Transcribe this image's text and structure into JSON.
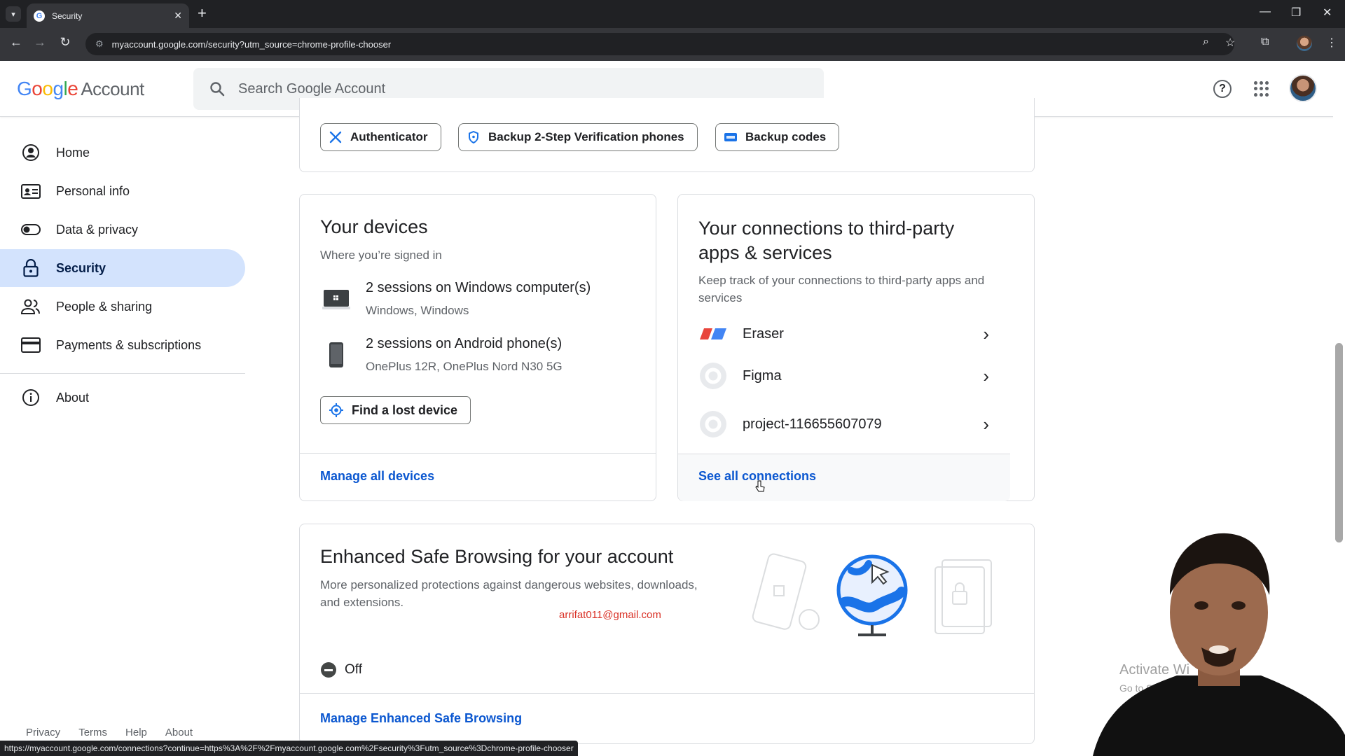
{
  "browser": {
    "tab_title": "Security",
    "url": "myaccount.google.com/security?utm_source=chrome-profile-chooser",
    "status_url": "https://myaccount.google.com/connections?continue=https%3A%2F%2Fmyaccount.google.com%2Fsecurity%3Futm_source%3Dchrome-profile-chooser"
  },
  "header": {
    "logo_letters": [
      "G",
      "o",
      "o",
      "g",
      "l",
      "e"
    ],
    "logo_suffix": "Account",
    "search_placeholder": "Search Google Account"
  },
  "sidebar": {
    "items": [
      {
        "label": "Home",
        "icon": "account-circle-icon"
      },
      {
        "label": "Personal info",
        "icon": "id-card-icon"
      },
      {
        "label": "Data & privacy",
        "icon": "toggle-icon"
      },
      {
        "label": "Security",
        "icon": "lock-icon",
        "active": true
      },
      {
        "label": "People & sharing",
        "icon": "people-icon"
      },
      {
        "label": "Payments & subscriptions",
        "icon": "credit-card-icon"
      },
      {
        "label": "About",
        "icon": "info-icon"
      }
    ],
    "footer": [
      "Privacy",
      "Terms",
      "Help",
      "About"
    ]
  },
  "two_step_chips": {
    "authenticator": "Authenticator",
    "backup_phones": "Backup 2-Step Verification phones",
    "backup_codes": "Backup codes"
  },
  "devices": {
    "title": "Your devices",
    "subtitle": "Where you’re signed in",
    "rows": [
      {
        "title": "2 sessions on Windows computer(s)",
        "sub": "Windows, Windows"
      },
      {
        "title": "2 sessions on Android phone(s)",
        "sub": "OnePlus 12R, OnePlus Nord N30 5G"
      }
    ],
    "find_button": "Find a lost device",
    "manage_link": "Manage all devices"
  },
  "connections": {
    "title_line1": "Your connections to third-party",
    "title_line2": "apps & services",
    "desc_line1": "Keep track of your connections to third-party apps and",
    "desc_line2": "services",
    "items": [
      {
        "name": "Eraser"
      },
      {
        "name": "Figma"
      },
      {
        "name": "project-116655607079"
      }
    ],
    "see_all": "See all connections"
  },
  "safe_browsing": {
    "title": "Enhanced Safe Browsing for your account",
    "desc_line1": "More personalized protections against dangerous websites, downloads,",
    "desc_line2": "and extensions.",
    "status": "Off",
    "manage_link": "Manage Enhanced Safe Browsing"
  },
  "overlay": {
    "email": "arrifat011@gmail.com",
    "activate_line1": "Activate Wi",
    "activate_line2": "Go to Settings to activate Windows."
  },
  "colors": {
    "accent_blue": "#0b57d0",
    "active_nav_bg": "#d3e3fd",
    "email_red": "#d93025"
  }
}
